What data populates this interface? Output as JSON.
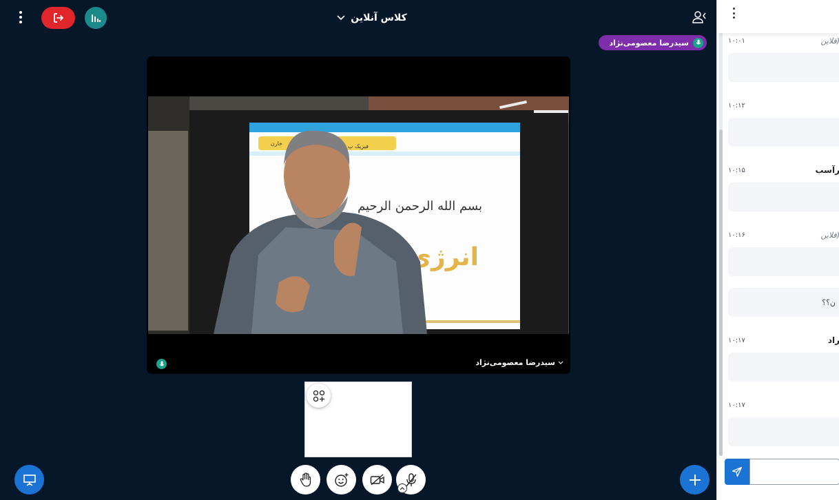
{
  "header": {
    "meeting_title": "کلاس آنلاین"
  },
  "talking_indicator": {
    "name": "سیدرضا معصومی‌نژاد"
  },
  "video": {
    "user_name": "سیدرضا معصومی‌نژاد",
    "slide_title": "بسم الله الرحمن الرحیم",
    "slide_subtitle": "انرژی",
    "slide_tab_1": "فیزیک پ",
    "slide_tab_2": "خارن"
  },
  "chat": {
    "messages": [
      {
        "time": "۱۰:۰۱",
        "sender": "فلاین)",
        "style": "italic"
      },
      {
        "time": "۱۰:۱۲",
        "sender": "",
        "style": "normal"
      },
      {
        "time": "۱۰:۱۵",
        "sender": "رآسب",
        "style": "bold"
      },
      {
        "time": "۱۰:۱۶",
        "sender": "فلاین)",
        "style": "italic"
      },
      {
        "time": "۱۰:۱۷",
        "sender": "راد",
        "style": "bold"
      },
      {
        "time": "۱۰:۱۷",
        "sender": "",
        "style": "normal"
      }
    ],
    "bubbles": [
      "",
      "",
      "",
      "",
      "ن؟؟",
      "",
      ""
    ],
    "input_placeholder": ""
  },
  "colors": {
    "background": "#06172a",
    "leave": "#e0262b",
    "stats": "#1a8a8a",
    "primary": "#1b73d4",
    "talker": "#7e2dab",
    "mic_active": "#19a38b"
  }
}
